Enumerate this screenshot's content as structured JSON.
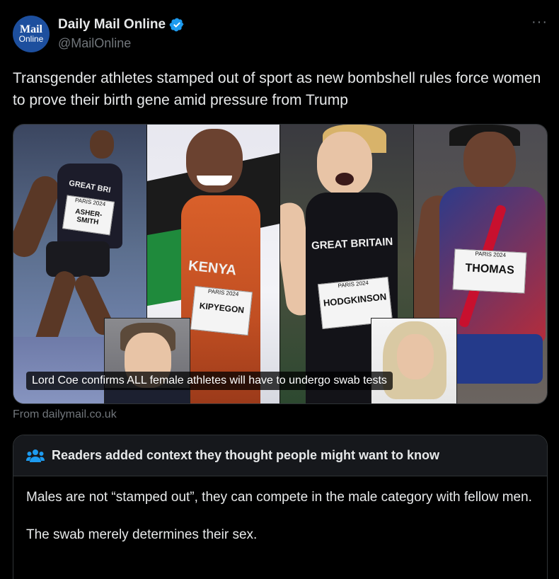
{
  "author": {
    "display_name": "Daily Mail Online",
    "handle": "@MailOnline",
    "avatar_line1": "Mail",
    "avatar_line2": "Online"
  },
  "more_label": "···",
  "tweet": {
    "text": "Transgender athletes stamped out of sport as new bombshell rules force women to prove their birth gene amid pressure from Trump"
  },
  "media": {
    "caption": "Lord Coe confirms ALL female athletes will have to undergo swab tests",
    "panels": [
      {
        "jersey": "GREAT BRI",
        "bib_top": "PARIS 2024",
        "bib_name": "ASHER-SMITH"
      },
      {
        "jersey": "KENYA",
        "bib_top": "PARIS 2024",
        "bib_name": "KIPYEGON"
      },
      {
        "jersey": "GREAT BRITAIN",
        "bib_top": "PARIS 2024",
        "bib_name": "HODGKINSON"
      },
      {
        "jersey": "",
        "bib_top": "PARIS 2024",
        "bib_name": "THOMAS"
      }
    ]
  },
  "source": "From dailymail.co.uk",
  "community_note": {
    "title": "Readers added context they thought people might want to know",
    "paragraphs": [
      "Males are not “stamped out”, they can compete in the male category with fellow men.",
      "The swab merely determines their sex."
    ]
  },
  "colors": {
    "verified_badge": "#1d9bf0",
    "avatar_bg": "#1d4f9e",
    "secondary_text": "#71767b",
    "note_icon": "#1d9bf0"
  }
}
